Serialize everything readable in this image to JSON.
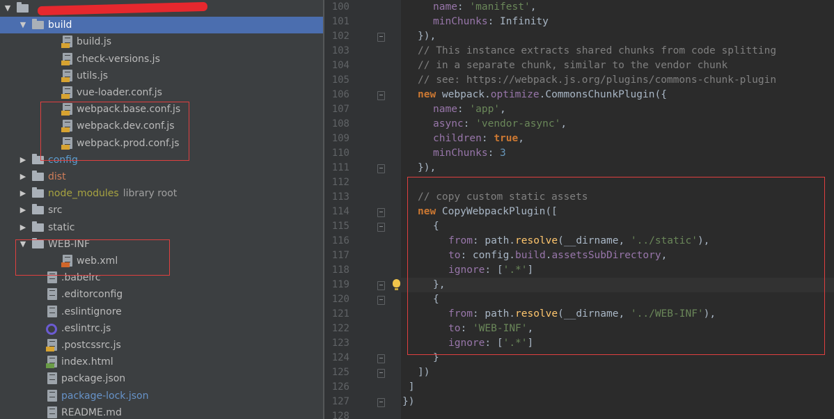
{
  "tree": {
    "rows": [
      {
        "type": "folder",
        "open": true,
        "indent": 0,
        "label": "",
        "redacted": true
      },
      {
        "type": "folder",
        "open": true,
        "indent": 1,
        "label": "build",
        "selected": true
      },
      {
        "type": "file",
        "indent": 2,
        "badge": "js",
        "label": "build.js"
      },
      {
        "type": "file",
        "indent": 2,
        "badge": "js",
        "label": "check-versions.js"
      },
      {
        "type": "file",
        "indent": 2,
        "badge": "js",
        "label": "utils.js"
      },
      {
        "type": "file",
        "indent": 2,
        "badge": "js",
        "label": "vue-loader.conf.js"
      },
      {
        "type": "file",
        "indent": 2,
        "badge": "js",
        "label": "webpack.base.conf.js"
      },
      {
        "type": "file",
        "indent": 2,
        "badge": "js",
        "label": "webpack.dev.conf.js"
      },
      {
        "type": "file",
        "indent": 2,
        "badge": "js",
        "label": "webpack.prod.conf.js"
      },
      {
        "type": "folder",
        "open": false,
        "indent": 1,
        "label": "config",
        "color": "teal"
      },
      {
        "type": "folder",
        "open": false,
        "indent": 1,
        "label": "dist",
        "color": "orange"
      },
      {
        "type": "folder",
        "open": false,
        "indent": 1,
        "label": "node_modules",
        "color": "olive",
        "suffix": "library root"
      },
      {
        "type": "folder",
        "open": false,
        "indent": 1,
        "label": "src"
      },
      {
        "type": "folder",
        "open": false,
        "indent": 1,
        "label": "static"
      },
      {
        "type": "folder",
        "open": true,
        "indent": 1,
        "label": "WEB-INF"
      },
      {
        "type": "file",
        "indent": 2,
        "badge": "xml",
        "label": "web.xml"
      },
      {
        "type": "file",
        "indent": 1,
        "badge": "",
        "label": ".babelrc"
      },
      {
        "type": "file",
        "indent": 1,
        "badge": "",
        "label": ".editorconfig"
      },
      {
        "type": "file",
        "indent": 1,
        "badge": "",
        "label": ".eslintignore"
      },
      {
        "type": "eslint",
        "indent": 1,
        "label": ".eslintrc.js"
      },
      {
        "type": "file",
        "indent": 1,
        "badge": "js",
        "label": ".postcssrc.js"
      },
      {
        "type": "file",
        "indent": 1,
        "badge": "html",
        "label": "index.html"
      },
      {
        "type": "file",
        "indent": 1,
        "badge": "",
        "label": "package.json"
      },
      {
        "type": "file",
        "indent": 1,
        "badge": "",
        "label": "package-lock.json",
        "color": "blue"
      },
      {
        "type": "file",
        "indent": 1,
        "badge": "",
        "label": "README.md"
      }
    ]
  },
  "editor": {
    "caret_line": 119,
    "fold_lines": [
      102,
      106,
      111,
      114,
      115,
      119,
      120,
      124,
      125,
      127
    ],
    "bulb_line": 119,
    "lines": [
      {
        "no": 100,
        "indent": 2,
        "tokens": [
          [
            "prop",
            "name"
          ],
          [
            "plain",
            ": "
          ],
          [
            "str",
            "'manifest'"
          ],
          [
            "plain",
            ","
          ]
        ]
      },
      {
        "no": 101,
        "indent": 2,
        "tokens": [
          [
            "prop",
            "minChunks"
          ],
          [
            "plain",
            ": "
          ],
          [
            "plain",
            "Infinity"
          ]
        ]
      },
      {
        "no": 102,
        "indent": 1,
        "tokens": [
          [
            "plain",
            "}),"
          ]
        ]
      },
      {
        "no": 103,
        "indent": 1,
        "tokens": [
          [
            "cmt",
            "// This instance extracts shared chunks from code splitting"
          ]
        ]
      },
      {
        "no": 104,
        "indent": 1,
        "tokens": [
          [
            "cmt",
            "// in a separate chunk, similar to the vendor chunk"
          ]
        ]
      },
      {
        "no": 105,
        "indent": 1,
        "tokens": [
          [
            "cmt",
            "// see: https://webpack.js.org/plugins/commons-chunk-plugin"
          ]
        ]
      },
      {
        "no": 106,
        "indent": 1,
        "tokens": [
          [
            "kw",
            "new "
          ],
          [
            "plain",
            "webpack."
          ],
          [
            "prop",
            "optimize"
          ],
          [
            "plain",
            ".CommonsChunkPlugin({"
          ]
        ]
      },
      {
        "no": 107,
        "indent": 2,
        "tokens": [
          [
            "prop",
            "name"
          ],
          [
            "plain",
            ": "
          ],
          [
            "str",
            "'app'"
          ],
          [
            "plain",
            ","
          ]
        ]
      },
      {
        "no": 108,
        "indent": 2,
        "tokens": [
          [
            "prop",
            "async"
          ],
          [
            "plain",
            ": "
          ],
          [
            "str",
            "'vendor-async'"
          ],
          [
            "plain",
            ","
          ]
        ]
      },
      {
        "no": 109,
        "indent": 2,
        "tokens": [
          [
            "prop",
            "children"
          ],
          [
            "plain",
            ": "
          ],
          [
            "kw",
            "true"
          ],
          [
            "plain",
            ","
          ]
        ]
      },
      {
        "no": 110,
        "indent": 2,
        "tokens": [
          [
            "prop",
            "minChunks"
          ],
          [
            "plain",
            ": "
          ],
          [
            "num",
            "3"
          ]
        ]
      },
      {
        "no": 111,
        "indent": 1,
        "tokens": [
          [
            "plain",
            "}),"
          ]
        ]
      },
      {
        "no": 112,
        "indent": 0,
        "tokens": []
      },
      {
        "no": 113,
        "indent": 1,
        "tokens": [
          [
            "cmt",
            "// copy custom static assets"
          ]
        ]
      },
      {
        "no": 114,
        "indent": 1,
        "tokens": [
          [
            "kw",
            "new "
          ],
          [
            "plain",
            "CopyWebpackPlugin(["
          ]
        ]
      },
      {
        "no": 115,
        "indent": 2,
        "tokens": [
          [
            "plain",
            "{"
          ]
        ]
      },
      {
        "no": 116,
        "indent": 3,
        "tokens": [
          [
            "prop",
            "from"
          ],
          [
            "plain",
            ": path."
          ],
          [
            "fn",
            "resolve"
          ],
          [
            "plain",
            "(__dirname, "
          ],
          [
            "str",
            "'../static'"
          ],
          [
            "plain",
            "),"
          ]
        ]
      },
      {
        "no": 117,
        "indent": 3,
        "tokens": [
          [
            "prop",
            "to"
          ],
          [
            "plain",
            ": config."
          ],
          [
            "prop",
            "build"
          ],
          [
            "plain",
            "."
          ],
          [
            "prop",
            "assetsSubDirectory"
          ],
          [
            "plain",
            ","
          ]
        ]
      },
      {
        "no": 118,
        "indent": 3,
        "tokens": [
          [
            "prop",
            "ignore"
          ],
          [
            "plain",
            ": ["
          ],
          [
            "str",
            "'.*'"
          ],
          [
            "plain",
            "]"
          ]
        ]
      },
      {
        "no": 119,
        "indent": 2,
        "tokens": [
          [
            "plain",
            "},"
          ]
        ]
      },
      {
        "no": 120,
        "indent": 2,
        "tokens": [
          [
            "plain",
            "{"
          ]
        ]
      },
      {
        "no": 121,
        "indent": 3,
        "tokens": [
          [
            "prop",
            "from"
          ],
          [
            "plain",
            ": path."
          ],
          [
            "fn",
            "resolve"
          ],
          [
            "plain",
            "(__dirname, "
          ],
          [
            "str",
            "'../WEB-INF'"
          ],
          [
            "plain",
            "),"
          ]
        ]
      },
      {
        "no": 122,
        "indent": 3,
        "tokens": [
          [
            "prop",
            "to"
          ],
          [
            "plain",
            ": "
          ],
          [
            "str",
            "'WEB-INF'"
          ],
          [
            "plain",
            ","
          ]
        ]
      },
      {
        "no": 123,
        "indent": 3,
        "tokens": [
          [
            "prop",
            "ignore"
          ],
          [
            "plain",
            ": ["
          ],
          [
            "str",
            "'.*'"
          ],
          [
            "plain",
            "]"
          ]
        ]
      },
      {
        "no": 124,
        "indent": 2,
        "tokens": [
          [
            "plain",
            "}"
          ]
        ]
      },
      {
        "no": 125,
        "indent": 1,
        "tokens": [
          [
            "plain",
            "])"
          ]
        ]
      },
      {
        "no": 126,
        "indent": 0,
        "tokens": [
          [
            "plain",
            " ]"
          ]
        ]
      },
      {
        "no": 127,
        "indent": 0,
        "tokens": [
          [
            "plain",
            "})"
          ]
        ]
      },
      {
        "no": 128,
        "indent": 0,
        "tokens": []
      }
    ]
  },
  "colors": {
    "selection": "#4b6eaf",
    "highlight_box": "#e04040",
    "keyword": "#cc7832",
    "string": "#6a8759",
    "comment": "#808080",
    "property": "#9876aa"
  },
  "icons": {
    "folder": "folder-icon",
    "file": "file-icon",
    "eslint": "eslint-icon",
    "bulb": "lightbulb-icon"
  }
}
